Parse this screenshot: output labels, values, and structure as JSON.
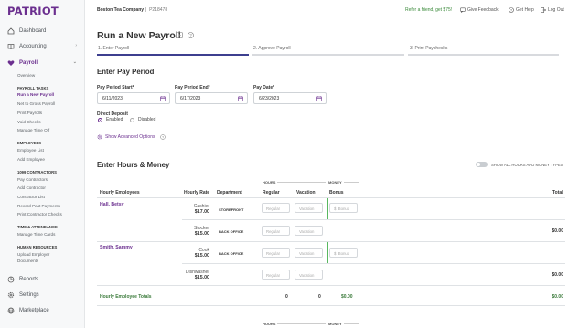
{
  "brand": {
    "logo": "PATRIOT",
    "color": "#6b2f8f"
  },
  "sidebar": {
    "items": [
      {
        "label": "Dashboard",
        "icon": "home-icon"
      },
      {
        "label": "Accounting",
        "icon": "book-icon"
      },
      {
        "label": "Payroll",
        "icon": "heart-icon"
      },
      {
        "label": "Reports",
        "icon": "chart-icon"
      },
      {
        "label": "Settings",
        "icon": "gear-icon"
      },
      {
        "label": "Marketplace",
        "icon": "globe-icon"
      }
    ],
    "payroll_sub": {
      "overview": "Overview",
      "tasks_head": "PAYROLL TASKS",
      "tasks": [
        "Run a New Payroll",
        "Net to Gross Payroll",
        "Print Payrolls",
        "Void Checks",
        "Manage Time Off"
      ],
      "employees_head": "EMPLOYEES",
      "employees": [
        "Employee List",
        "Add Employee"
      ],
      "contractors_head": "1099 CONTRACTORS",
      "contractors": [
        "Pay Contractors",
        "Add Contractor",
        "Contractor List",
        "Record Past Payments",
        "Print Contractor Checks"
      ],
      "time_head": "TIME & ATTENDANCE",
      "time": [
        "Manage Time Cards"
      ],
      "hr_head": "HUMAN RESOURCES",
      "hr": [
        "Upload Employer",
        "Documents"
      ]
    }
  },
  "topbar": {
    "company": "Boston Tea Company",
    "company_id": "P218478",
    "refer": "Refer a friend, get $75!",
    "feedback": "Give Feedback",
    "help": "Get Help",
    "logout": "Log Out"
  },
  "page": {
    "title": "Run a New Payroll",
    "steps": [
      "1. Enter Payroll",
      "2. Approve Payroll",
      "3. Print Paychecks"
    ]
  },
  "pay_period": {
    "title": "Enter Pay Period",
    "start_label": "Pay Period Start*",
    "start_value": "6/11/2023",
    "end_label": "Pay Period End*",
    "end_value": "6/17/2023",
    "date_label": "Pay Date*",
    "date_value": "6/23/2023",
    "direct_deposit_label": "Direct Deposit",
    "enabled": "Enabled",
    "disabled": "Disabled",
    "advanced": "Show Advanced Options"
  },
  "hours": {
    "title": "Enter Hours & Money",
    "toggle_label": "SHOW ALL HOURS AND MONEY TYPES",
    "group_hours": "HOURS",
    "group_money": "MONEY",
    "columns": {
      "employees": "Hourly Employees",
      "rate": "Hourly Rate",
      "department": "Department",
      "regular": "Regular",
      "vacation": "Vacation",
      "bonus": "Bonus",
      "total": "Total"
    },
    "placeholders": {
      "regular": "Regular",
      "vacation": "Vacation",
      "bonus": "Bonus"
    },
    "rows": [
      {
        "name": "Hall, Betsy",
        "rate_label": "Cashier",
        "rate": "$17.00",
        "department": "STOREFRONT",
        "total": ""
      },
      {
        "name": "",
        "rate_label": "Stocker",
        "rate": "$15.00",
        "department": "BACK OFFICE",
        "total": "$0.00"
      },
      {
        "name": "Smith, Sammy",
        "rate_label": "Cook",
        "rate": "$15.00",
        "department": "BACK OFFICE",
        "total": ""
      },
      {
        "name": "",
        "rate_label": "Dishwasher",
        "rate": "$15.00",
        "department": "",
        "total": "$0.00"
      }
    ],
    "totals": {
      "label": "Hourly Employee Totals",
      "regular": "0",
      "vacation": "0",
      "bonus": "$0.00",
      "total": "$0.00"
    }
  }
}
